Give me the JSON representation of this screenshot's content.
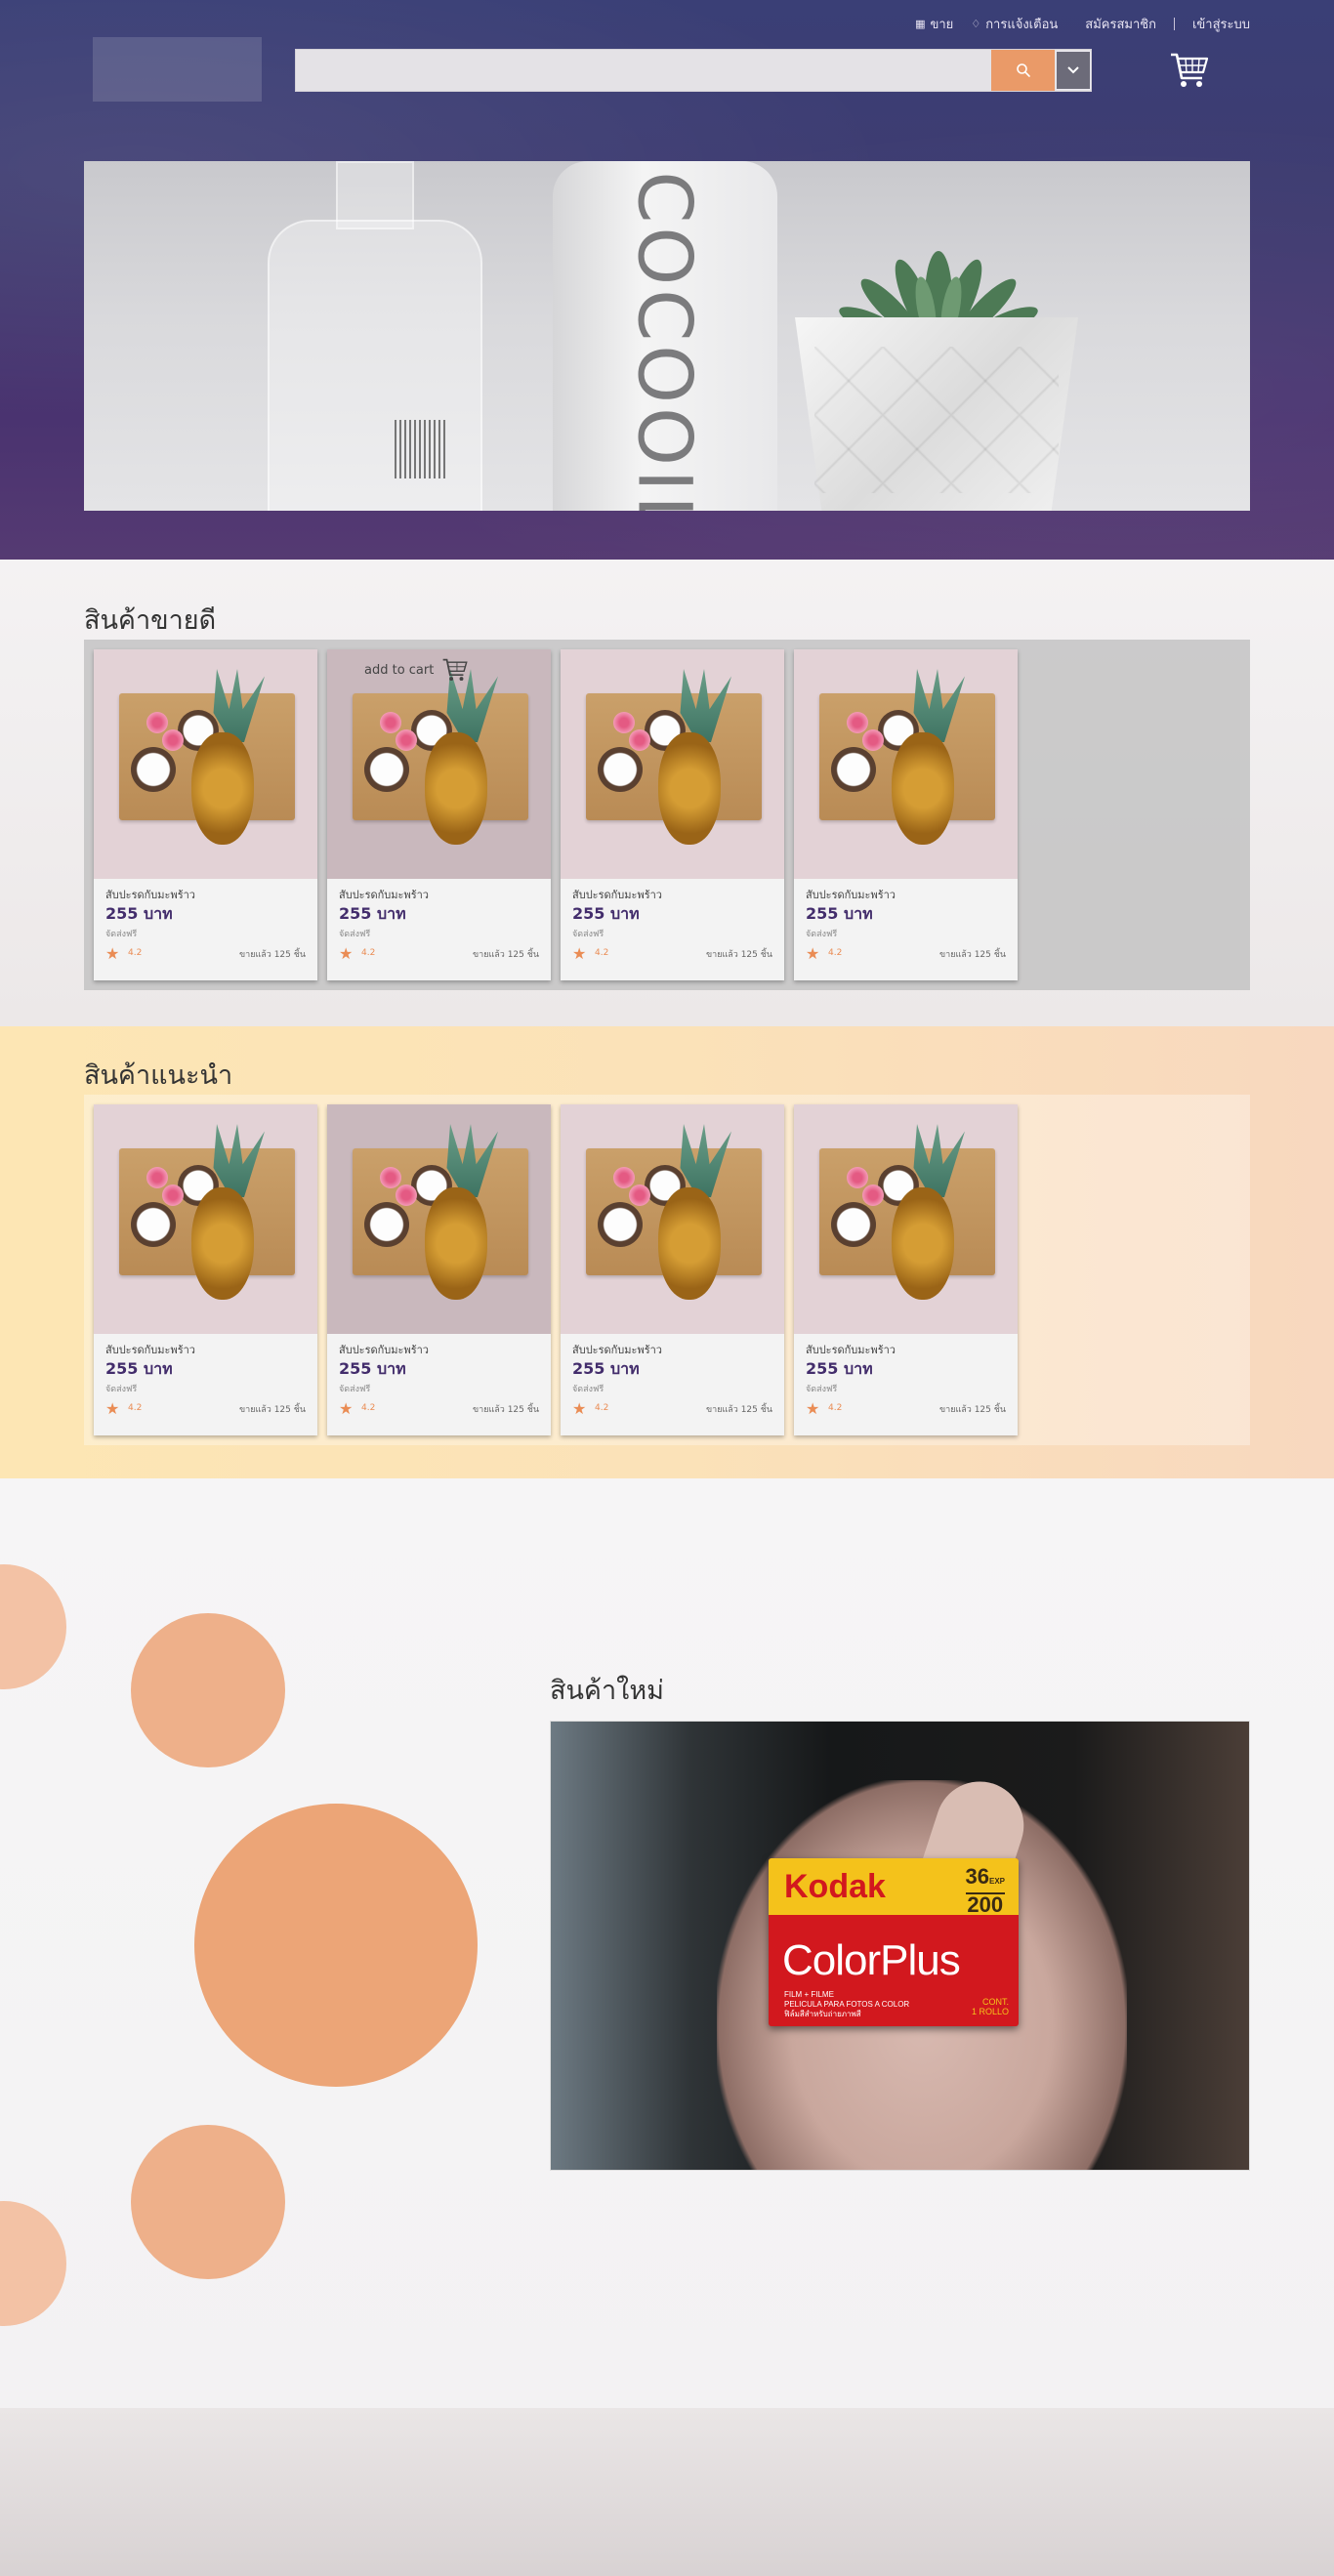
{
  "header": {
    "top_links": {
      "sell": "ขาย",
      "notifications": "การแจ้งเตือน",
      "register": "สมัครสมาชิก",
      "login": "เข้าสู่ระบบ"
    },
    "search": {
      "placeholder": "",
      "value": ""
    },
    "icons": {
      "sell": "store-icon",
      "notifications": "bell-icon",
      "search": "search-icon",
      "dropdown": "chevron-down-icon",
      "cart": "shopping-cart-icon"
    },
    "colors": {
      "search_button": "#ea9a68",
      "dropdown_button": "#6c6b79",
      "header_bg": "#3f3b70"
    }
  },
  "banner": {
    "brand_text": "COCOOIL",
    "slides_count": 8,
    "active_slide": 2
  },
  "best_sellers": {
    "title": "สินค้าขายดี",
    "add_to_cart_label": "add to cart",
    "products": [
      {
        "name": "สับปะรดกับมะพร้าว",
        "price": "255 บาท",
        "shipping": "จัดส่งฟรี",
        "rating": "4.2",
        "sold": "ขายแล้ว 125 ชิ้น"
      },
      {
        "name": "สับปะรดกับมะพร้าว",
        "price": "255 บาท",
        "shipping": "จัดส่งฟรี",
        "rating": "4.2",
        "sold": "ขายแล้ว 125 ชิ้น"
      },
      {
        "name": "สับปะรดกับมะพร้าว",
        "price": "255 บาท",
        "shipping": "จัดส่งฟรี",
        "rating": "4.2",
        "sold": "ขายแล้ว 125 ชิ้น"
      },
      {
        "name": "สับปะรดกับมะพร้าว",
        "price": "255 บาท",
        "shipping": "จัดส่งฟรี",
        "rating": "4.2",
        "sold": "ขายแล้ว 125 ชิ้น"
      }
    ]
  },
  "recommended": {
    "title": "สินค้าแนะนำ",
    "products": [
      {
        "name": "สับปะรดกับมะพร้าว",
        "price": "255 บาท",
        "shipping": "จัดส่งฟรี",
        "rating": "4.2",
        "sold": "ขายแล้ว 125 ชิ้น"
      },
      {
        "name": "สับปะรดกับมะพร้าว",
        "price": "255 บาท",
        "shipping": "จัดส่งฟรี",
        "rating": "4.2",
        "sold": "ขายแล้ว 125 ชิ้น"
      },
      {
        "name": "สับปะรดกับมะพร้าว",
        "price": "255 บาท",
        "shipping": "จัดส่งฟรี",
        "rating": "4.2",
        "sold": "ขายแล้ว 125 ชิ้น"
      },
      {
        "name": "สับปะรดกับมะพร้าว",
        "price": "255 บาท",
        "shipping": "จัดส่งฟรี",
        "rating": "4.2",
        "sold": "ขายแล้ว 125 ชิ้น"
      }
    ]
  },
  "new_products": {
    "title": "สินค้าใหม่",
    "photo_text": {
      "brand": "Kodak",
      "exposures": "36",
      "exposures_suffix": "EXP",
      "iso": "200",
      "product": "ColorPlus",
      "line1": "FILM + FILME",
      "line2": "PELICULA PARA FOTOS A COLOR",
      "line3": "ฟิล์มสีสำหรับถ่ายภาพสี",
      "cont1": "CONT.",
      "cont2": "1 ROLLO"
    },
    "colors": {
      "circles": "#eea679"
    }
  }
}
